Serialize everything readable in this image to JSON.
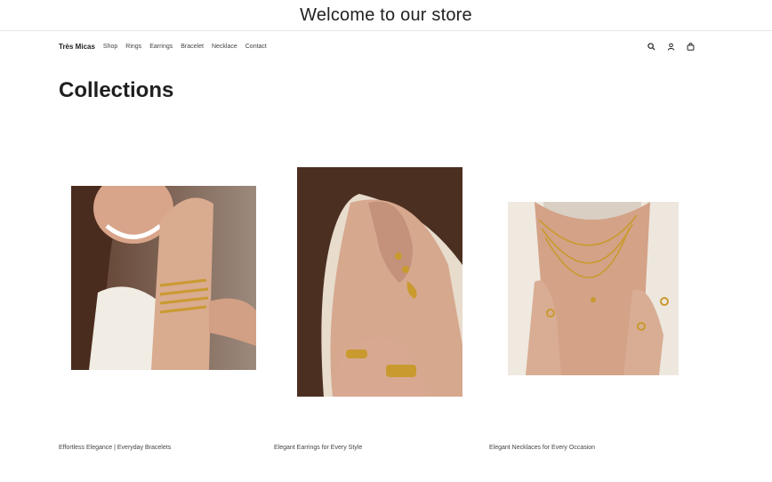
{
  "announcement": {
    "text": "Welcome to our store"
  },
  "header": {
    "brand": "Très Micas",
    "nav": [
      "Shop",
      "Rings",
      "Earrings",
      "Bracelet",
      "Necklace",
      "Contact"
    ],
    "icons": [
      "search-icon",
      "account-icon",
      "cart-icon"
    ]
  },
  "main": {
    "title": "Collections",
    "collections": [
      {
        "caption": "Effortless Elegance | Everyday Bracelets",
        "image": "bracelets-photo"
      },
      {
        "caption": "Elegant Earrings for Every Style",
        "image": "earrings-photo"
      },
      {
        "caption": "Elegant Necklaces for Every Occasion",
        "image": "necklaces-photo"
      }
    ]
  },
  "colors": {
    "text": "#1a1a1a",
    "muted": "#444444",
    "gold": "#c99a2e",
    "skin": "#d9ab8f"
  }
}
